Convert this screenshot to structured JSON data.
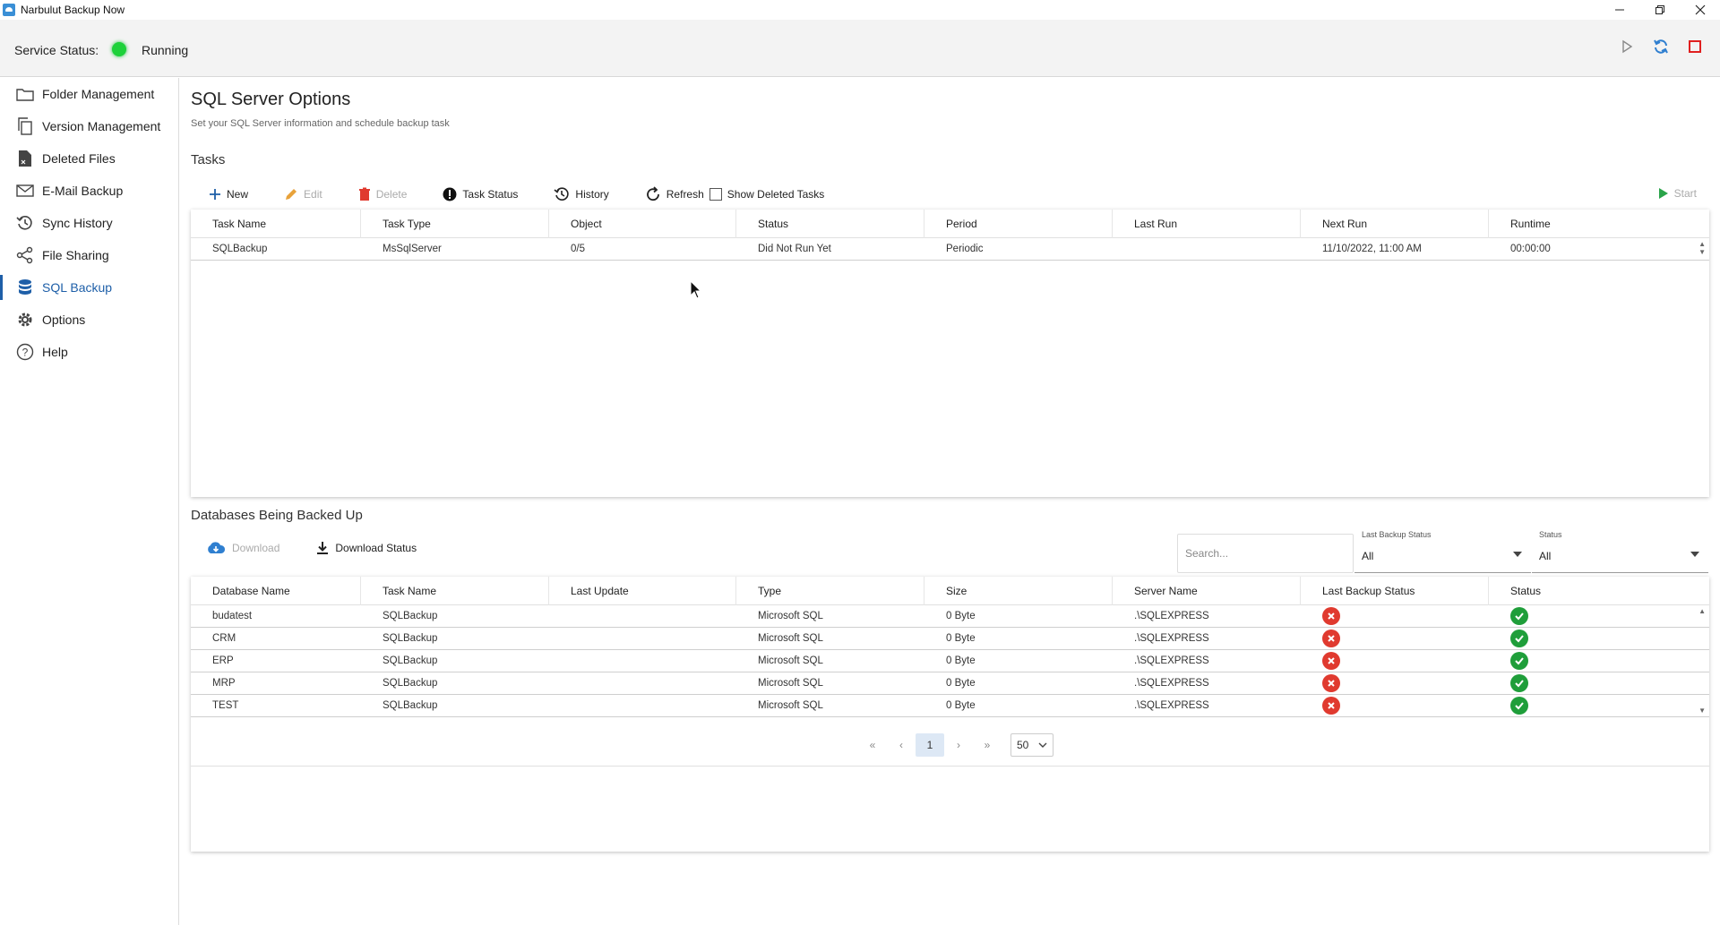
{
  "window": {
    "title": "Narbulut Backup Now"
  },
  "service": {
    "label": "Service Status:",
    "state": "Running",
    "status_color": "#1dd13a"
  },
  "sidebar": {
    "items": [
      {
        "label": "Folder Management",
        "icon": "folder-icon"
      },
      {
        "label": "Version Management",
        "icon": "copy-icon"
      },
      {
        "label": "Deleted Files",
        "icon": "deleted-file-icon"
      },
      {
        "label": "E-Mail Backup",
        "icon": "mail-icon"
      },
      {
        "label": "Sync History",
        "icon": "history-icon"
      },
      {
        "label": "File Sharing",
        "icon": "share-icon"
      },
      {
        "label": "SQL Backup",
        "icon": "database-icon",
        "active": true
      },
      {
        "label": "Options",
        "icon": "gear-icon"
      },
      {
        "label": "Help",
        "icon": "help-icon"
      }
    ]
  },
  "page": {
    "title": "SQL Server Options",
    "subtitle": "Set your SQL Server information and schedule backup task"
  },
  "tasks": {
    "section_title": "Tasks",
    "toolbar": {
      "new": "New",
      "edit": "Edit",
      "delete": "Delete",
      "task_status": "Task Status",
      "history": "History",
      "refresh": "Refresh",
      "show_deleted": "Show Deleted Tasks",
      "start": "Start"
    },
    "columns": [
      "Task Name",
      "Task Type",
      "Object",
      "Status",
      "Period",
      "Last Run",
      "Next Run",
      "Runtime"
    ],
    "rows": [
      [
        "SQLBackup",
        "MsSqlServer",
        "0/5",
        "Did Not Run Yet",
        "Periodic",
        "",
        "11/10/2022, 11:00 AM",
        "00:00:00"
      ]
    ]
  },
  "databases": {
    "section_title": "Databases Being Backed Up",
    "toolbar": {
      "download": "Download",
      "download_status": "Download Status"
    },
    "search_placeholder": "Search...",
    "last_backup_filter": {
      "label": "Last Backup Status",
      "value": "All"
    },
    "status_filter": {
      "label": "Status",
      "value": "All"
    },
    "columns": [
      "Database Name",
      "Task Name",
      "Last Update",
      "Type",
      "Size",
      "Server Name",
      "Last Backup Status",
      "Status"
    ],
    "rows": [
      [
        "budatest",
        "SQLBackup",
        "",
        "Microsoft SQL",
        "0 Byte",
        ".\\SQLEXPRESS",
        "error",
        "ok"
      ],
      [
        "CRM",
        "SQLBackup",
        "",
        "Microsoft SQL",
        "0 Byte",
        ".\\SQLEXPRESS",
        "error",
        "ok"
      ],
      [
        "ERP",
        "SQLBackup",
        "",
        "Microsoft SQL",
        "0 Byte",
        ".\\SQLEXPRESS",
        "error",
        "ok"
      ],
      [
        "MRP",
        "SQLBackup",
        "",
        "Microsoft SQL",
        "0 Byte",
        ".\\SQLEXPRESS",
        "error",
        "ok"
      ],
      [
        "TEST",
        "SQLBackup",
        "",
        "Microsoft SQL",
        "0 Byte",
        ".\\SQLEXPRESS",
        "error",
        "ok"
      ]
    ],
    "pager": {
      "current_page": "1",
      "page_size": "50"
    }
  }
}
